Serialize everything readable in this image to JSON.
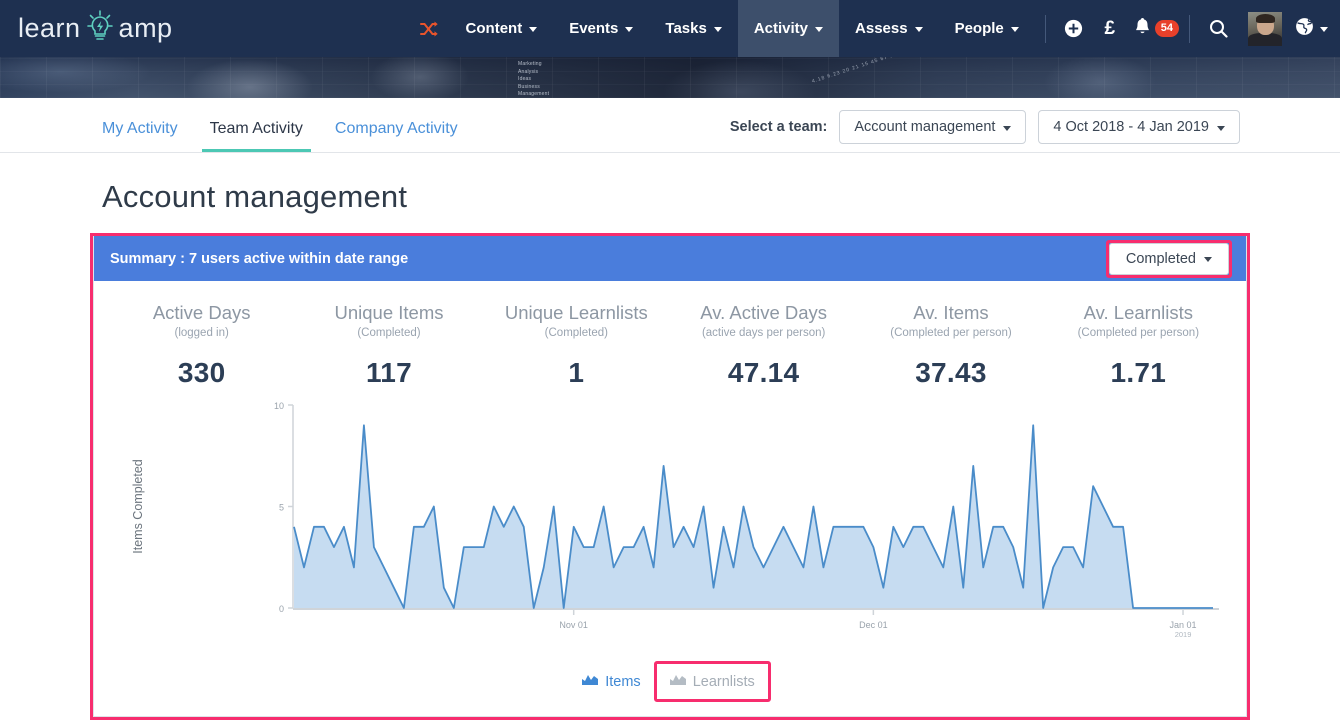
{
  "brand": {
    "part1": "learn",
    "part2": "amp",
    "icon": "lightbulb-icon"
  },
  "topnav": {
    "shuffle_icon": "shuffle-icon",
    "items": [
      {
        "label": "Content",
        "active": false
      },
      {
        "label": "Events",
        "active": false
      },
      {
        "label": "Tasks",
        "active": false
      },
      {
        "label": "Activity",
        "active": true
      },
      {
        "label": "Assess",
        "active": false
      },
      {
        "label": "People",
        "active": false
      }
    ],
    "add_icon": "plus-circle-icon",
    "currency_label": "£",
    "bell_icon": "bell-icon",
    "notification_count": "54",
    "search_icon": "search-icon",
    "avatar": "user-avatar",
    "globe_icon": "globe-icon"
  },
  "banner": {
    "keywords": "Marketing\nAnalysis\nIdeas\nBusiness\nManagement",
    "numbers": "4.18 6.23 20 21 15 45 67 12"
  },
  "tabs": [
    {
      "label": "My Activity",
      "active": false
    },
    {
      "label": "Team Activity",
      "active": true
    },
    {
      "label": "Company Activity",
      "active": false
    }
  ],
  "team_selector": {
    "label": "Select a team:",
    "team_value": "Account management",
    "date_range_value": "4 Oct 2018 - 4 Jan 2019"
  },
  "page_title": "Account management",
  "panel": {
    "summary_title": "Summary : 7 users active within date range",
    "status_filter_value": "Completed"
  },
  "stats": [
    {
      "label": "Active Days",
      "sub": "(logged in)",
      "value": "330"
    },
    {
      "label": "Unique Items",
      "sub": "(Completed)",
      "value": "117"
    },
    {
      "label": "Unique Learnlists",
      "sub": "(Completed)",
      "value": "1"
    },
    {
      "label": "Av. Active Days",
      "sub": "(active days per person)",
      "value": "47.14"
    },
    {
      "label": "Av. Items",
      "sub": "(Completed per person)",
      "value": "37.43"
    },
    {
      "label": "Av. Learnlists",
      "sub": "(Completed per person)",
      "value": "1.71"
    }
  ],
  "legend": [
    {
      "label": "Items",
      "state": "active",
      "icon": "area-chart-icon"
    },
    {
      "label": "Learnlists",
      "state": "inactive",
      "icon": "area-chart-icon",
      "highlighted": true
    }
  ],
  "colors": {
    "nav_bg": "#1e3050",
    "nav_active": "#3d4f6b",
    "brand_accent": "#5ecfbf",
    "tab_active_underline": "#4cc8b4",
    "link_blue": "#4a90d9",
    "panel_head_blue": "#4a7ddc",
    "highlight_pink": "#f72d6e",
    "badge_red": "#e8402a",
    "chart_line": "#4a8cc9",
    "chart_fill": "#c6dcf1",
    "stat_value": "#2c3e56"
  },
  "chart_data": {
    "type": "area",
    "title": "",
    "xlabel": "",
    "ylabel": "Items Completed",
    "ylim": [
      0,
      10
    ],
    "yticks": [
      0,
      5,
      10
    ],
    "ytick_labels": [
      "0",
      "5",
      "10"
    ],
    "grid": false,
    "legend_position": "bottom",
    "x_axis_ticks": [
      {
        "label": "Nov 01",
        "sublabel": "",
        "index": 28
      },
      {
        "label": "Dec 01",
        "sublabel": "",
        "index": 58
      },
      {
        "label": "Jan 01",
        "sublabel": "2019",
        "index": 89
      }
    ],
    "x_start": "4 Oct 2018",
    "x_end": "4 Jan 2019",
    "series": [
      {
        "name": "Items",
        "color": "#4a8cc9",
        "fill": "#c6dcf1",
        "values": [
          4,
          2,
          4,
          4,
          3,
          4,
          2,
          9,
          3,
          2,
          1,
          0,
          4,
          4,
          5,
          1,
          0,
          3,
          3,
          3,
          5,
          4,
          5,
          4,
          0,
          2,
          5,
          0,
          4,
          3,
          3,
          5,
          2,
          3,
          3,
          4,
          2,
          7,
          3,
          4,
          3,
          5,
          1,
          4,
          2,
          5,
          3,
          2,
          3,
          4,
          3,
          2,
          5,
          2,
          4,
          4,
          4,
          4,
          3,
          1,
          4,
          3,
          4,
          4,
          3,
          2,
          5,
          1,
          7,
          2,
          4,
          4,
          3,
          1,
          9,
          0,
          2,
          3,
          3,
          2,
          6,
          5,
          4,
          4,
          0,
          0,
          0,
          0,
          0,
          0,
          0,
          0,
          0
        ]
      },
      {
        "name": "Learnlists",
        "color": "#a5adb6",
        "fill": "none",
        "visible": false,
        "values": []
      }
    ]
  }
}
